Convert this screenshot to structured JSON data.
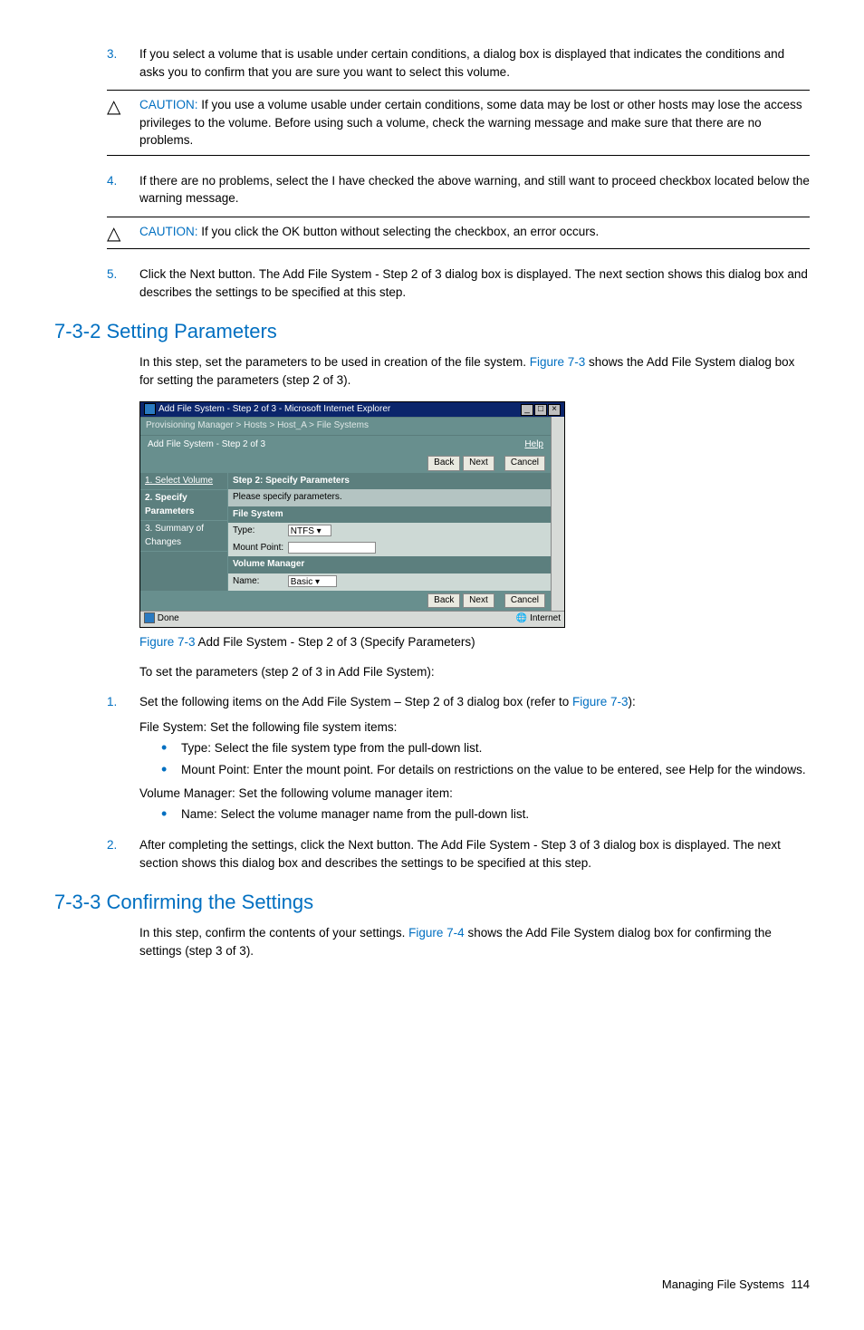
{
  "steps_top": {
    "s3": {
      "num": "3.",
      "text": "If you select a volume that is usable under certain conditions, a dialog box is displayed that indicates the conditions and asks you to confirm that you are sure you want to select this volume."
    },
    "s4": {
      "num": "4.",
      "text": "If there are no problems, select the I have checked the above warning, and still want to proceed checkbox located below the warning message."
    },
    "s5": {
      "num": "5.",
      "text": "Click the Next button. The Add File System - Step 2 of 3 dialog box is displayed. The next section shows this dialog box and describes the settings to be specified at this step."
    }
  },
  "cautions": {
    "c1_label": "CAUTION:",
    "c1_text": "  If you use a volume usable under certain conditions, some data may be lost or other hosts may lose the access privileges to the volume. Before using such a volume, check the warning message and make sure that there are no problems.",
    "c2_label": "CAUTION:",
    "c2_text": "  If you click the OK button without selecting the checkbox, an error occurs."
  },
  "section1": {
    "title": "7-3-2 Setting Parameters",
    "intro_before": "In this step, set the parameters to be used in creation of the file system. ",
    "intro_link": "Figure 7-3",
    "intro_after": " shows the Add File System dialog box for setting the parameters (step 2 of 3).",
    "fig_ref": "Figure 7-3",
    "fig_caption": " Add File System - Step 2 of 3 (Specify Parameters)",
    "p2": "To set the parameters (step 2 of 3 in Add File System):",
    "ol1": {
      "num": "1.",
      "line1_before": "Set the following items on the Add File System – Step 2 of 3 dialog box (refer to ",
      "line1_link": "Figure 7-3",
      "line1_after": "):",
      "line2": "File System: Set the following file system items:",
      "b1": "Type: Select the file system type from the pull-down list.",
      "b2": "Mount Point: Enter the mount point. For details on restrictions on the value to be entered, see Help for the windows.",
      "line3": "Volume Manager: Set the following volume manager item:",
      "b3": "Name: Select the volume manager name from the pull-down list."
    },
    "ol2": {
      "num": "2.",
      "text": "After completing the settings, click the Next button. The Add File System - Step 3 of 3 dialog box is displayed. The next section shows this dialog box and describes the settings to be specified at this step."
    }
  },
  "section2": {
    "title": "7-3-3 Confirming the Settings",
    "intro_before": "In this step, confirm the contents of your settings. ",
    "intro_link": "Figure 7-4",
    "intro_after": " shows the Add File System dialog box for confirming the settings (step 3 of 3)."
  },
  "screenshot": {
    "title": "Add File System - Step 2 of 3 - Microsoft Internet Explorer",
    "breadcrumb": "Provisioning Manager > Hosts > Host_A > File Systems",
    "page_title": "Add File System - Step 2 of 3",
    "help": "Help",
    "back": "Back",
    "next": "Next",
    "cancel": "Cancel",
    "side1": "1. Select Volume",
    "side2": "2. Specify Parameters",
    "side3": "3. Summary of Changes",
    "step_hdr": "Step 2: Specify Parameters",
    "step_sub": "Please specify parameters.",
    "group1": "File System",
    "type_lbl": "Type:",
    "type_val": "NTFS",
    "mount_lbl": "Mount Point:",
    "group2": "Volume Manager",
    "name_lbl": "Name:",
    "name_val": "Basic",
    "status_done": "Done",
    "status_net": "Internet"
  },
  "footer": {
    "label": "Managing File Systems",
    "page": "114"
  }
}
